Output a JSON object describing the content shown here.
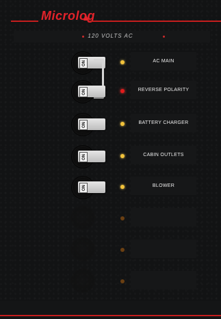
{
  "brand": "Microlog",
  "voltage_label": "120 VOLTS AC",
  "circuits": [
    {
      "label": "AC MAIN",
      "switch_text": "ON",
      "led": "yellow"
    },
    {
      "label": "REVERSE POLARITY",
      "switch_text": "ON",
      "led": "red"
    },
    {
      "label": "BATTERY CHARGER",
      "switch_text": "ON",
      "led": "yellow"
    },
    {
      "label": "CABIN OUTLETS",
      "switch_text": "ON",
      "led": "yellow"
    },
    {
      "label": "BLOWER",
      "switch_text": "ON",
      "led": "yellow"
    }
  ],
  "empty_slots": [
    {
      "led": "off"
    },
    {
      "led": "off"
    },
    {
      "led": "off"
    }
  ],
  "colors": {
    "accent": "#e3232b",
    "led_on": "#f2c23a",
    "led_fault": "#e21b1b",
    "led_off": "#6a3f12"
  }
}
